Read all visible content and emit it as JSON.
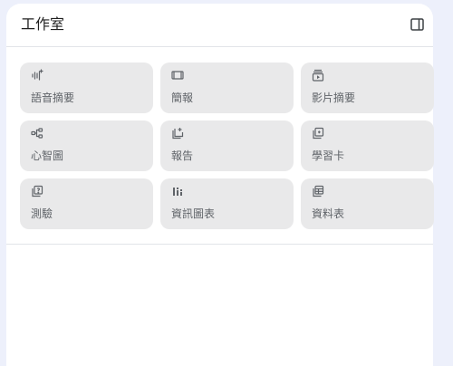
{
  "studio": {
    "title": "工作室",
    "collapse_icon": "side-panel-icon"
  },
  "tools": [
    {
      "label": "語音摘要",
      "icon": "audio-waveform-icon"
    },
    {
      "label": "簡報",
      "icon": "slides-icon"
    },
    {
      "label": "影片摘要",
      "icon": "video-summary-icon"
    },
    {
      "label": "心智圖",
      "icon": "mind-map-icon"
    },
    {
      "label": "報告",
      "icon": "report-icon"
    },
    {
      "label": "學習卡",
      "icon": "flashcards-icon"
    },
    {
      "label": "測驗",
      "icon": "quiz-icon"
    },
    {
      "label": "資訊圖表",
      "icon": "infographic-icon"
    },
    {
      "label": "資料表",
      "icon": "data-table-icon"
    }
  ],
  "colors": {
    "background": "#edf0fb",
    "panel": "#ffffff",
    "tile": "#e9e9ea",
    "label": "#5f6368",
    "icon": "#5f6368"
  }
}
